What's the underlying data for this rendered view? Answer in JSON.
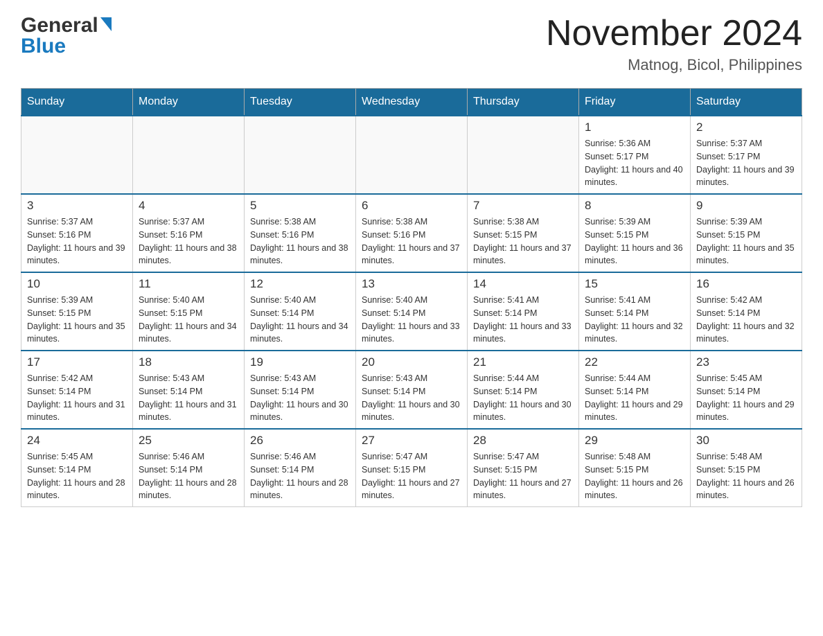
{
  "header": {
    "logo": {
      "general_text": "General",
      "blue_text": "Blue"
    },
    "month_title": "November 2024",
    "location": "Matnog, Bicol, Philippines"
  },
  "days_of_week": [
    "Sunday",
    "Monday",
    "Tuesday",
    "Wednesday",
    "Thursday",
    "Friday",
    "Saturday"
  ],
  "weeks": [
    {
      "days": [
        {
          "number": "",
          "sunrise": "",
          "sunset": "",
          "daylight": ""
        },
        {
          "number": "",
          "sunrise": "",
          "sunset": "",
          "daylight": ""
        },
        {
          "number": "",
          "sunrise": "",
          "sunset": "",
          "daylight": ""
        },
        {
          "number": "",
          "sunrise": "",
          "sunset": "",
          "daylight": ""
        },
        {
          "number": "",
          "sunrise": "",
          "sunset": "",
          "daylight": ""
        },
        {
          "number": "1",
          "sunrise": "Sunrise: 5:36 AM",
          "sunset": "Sunset: 5:17 PM",
          "daylight": "Daylight: 11 hours and 40 minutes."
        },
        {
          "number": "2",
          "sunrise": "Sunrise: 5:37 AM",
          "sunset": "Sunset: 5:17 PM",
          "daylight": "Daylight: 11 hours and 39 minutes."
        }
      ]
    },
    {
      "days": [
        {
          "number": "3",
          "sunrise": "Sunrise: 5:37 AM",
          "sunset": "Sunset: 5:16 PM",
          "daylight": "Daylight: 11 hours and 39 minutes."
        },
        {
          "number": "4",
          "sunrise": "Sunrise: 5:37 AM",
          "sunset": "Sunset: 5:16 PM",
          "daylight": "Daylight: 11 hours and 38 minutes."
        },
        {
          "number": "5",
          "sunrise": "Sunrise: 5:38 AM",
          "sunset": "Sunset: 5:16 PM",
          "daylight": "Daylight: 11 hours and 38 minutes."
        },
        {
          "number": "6",
          "sunrise": "Sunrise: 5:38 AM",
          "sunset": "Sunset: 5:16 PM",
          "daylight": "Daylight: 11 hours and 37 minutes."
        },
        {
          "number": "7",
          "sunrise": "Sunrise: 5:38 AM",
          "sunset": "Sunset: 5:15 PM",
          "daylight": "Daylight: 11 hours and 37 minutes."
        },
        {
          "number": "8",
          "sunrise": "Sunrise: 5:39 AM",
          "sunset": "Sunset: 5:15 PM",
          "daylight": "Daylight: 11 hours and 36 minutes."
        },
        {
          "number": "9",
          "sunrise": "Sunrise: 5:39 AM",
          "sunset": "Sunset: 5:15 PM",
          "daylight": "Daylight: 11 hours and 35 minutes."
        }
      ]
    },
    {
      "days": [
        {
          "number": "10",
          "sunrise": "Sunrise: 5:39 AM",
          "sunset": "Sunset: 5:15 PM",
          "daylight": "Daylight: 11 hours and 35 minutes."
        },
        {
          "number": "11",
          "sunrise": "Sunrise: 5:40 AM",
          "sunset": "Sunset: 5:15 PM",
          "daylight": "Daylight: 11 hours and 34 minutes."
        },
        {
          "number": "12",
          "sunrise": "Sunrise: 5:40 AM",
          "sunset": "Sunset: 5:14 PM",
          "daylight": "Daylight: 11 hours and 34 minutes."
        },
        {
          "number": "13",
          "sunrise": "Sunrise: 5:40 AM",
          "sunset": "Sunset: 5:14 PM",
          "daylight": "Daylight: 11 hours and 33 minutes."
        },
        {
          "number": "14",
          "sunrise": "Sunrise: 5:41 AM",
          "sunset": "Sunset: 5:14 PM",
          "daylight": "Daylight: 11 hours and 33 minutes."
        },
        {
          "number": "15",
          "sunrise": "Sunrise: 5:41 AM",
          "sunset": "Sunset: 5:14 PM",
          "daylight": "Daylight: 11 hours and 32 minutes."
        },
        {
          "number": "16",
          "sunrise": "Sunrise: 5:42 AM",
          "sunset": "Sunset: 5:14 PM",
          "daylight": "Daylight: 11 hours and 32 minutes."
        }
      ]
    },
    {
      "days": [
        {
          "number": "17",
          "sunrise": "Sunrise: 5:42 AM",
          "sunset": "Sunset: 5:14 PM",
          "daylight": "Daylight: 11 hours and 31 minutes."
        },
        {
          "number": "18",
          "sunrise": "Sunrise: 5:43 AM",
          "sunset": "Sunset: 5:14 PM",
          "daylight": "Daylight: 11 hours and 31 minutes."
        },
        {
          "number": "19",
          "sunrise": "Sunrise: 5:43 AM",
          "sunset": "Sunset: 5:14 PM",
          "daylight": "Daylight: 11 hours and 30 minutes."
        },
        {
          "number": "20",
          "sunrise": "Sunrise: 5:43 AM",
          "sunset": "Sunset: 5:14 PM",
          "daylight": "Daylight: 11 hours and 30 minutes."
        },
        {
          "number": "21",
          "sunrise": "Sunrise: 5:44 AM",
          "sunset": "Sunset: 5:14 PM",
          "daylight": "Daylight: 11 hours and 30 minutes."
        },
        {
          "number": "22",
          "sunrise": "Sunrise: 5:44 AM",
          "sunset": "Sunset: 5:14 PM",
          "daylight": "Daylight: 11 hours and 29 minutes."
        },
        {
          "number": "23",
          "sunrise": "Sunrise: 5:45 AM",
          "sunset": "Sunset: 5:14 PM",
          "daylight": "Daylight: 11 hours and 29 minutes."
        }
      ]
    },
    {
      "days": [
        {
          "number": "24",
          "sunrise": "Sunrise: 5:45 AM",
          "sunset": "Sunset: 5:14 PM",
          "daylight": "Daylight: 11 hours and 28 minutes."
        },
        {
          "number": "25",
          "sunrise": "Sunrise: 5:46 AM",
          "sunset": "Sunset: 5:14 PM",
          "daylight": "Daylight: 11 hours and 28 minutes."
        },
        {
          "number": "26",
          "sunrise": "Sunrise: 5:46 AM",
          "sunset": "Sunset: 5:14 PM",
          "daylight": "Daylight: 11 hours and 28 minutes."
        },
        {
          "number": "27",
          "sunrise": "Sunrise: 5:47 AM",
          "sunset": "Sunset: 5:15 PM",
          "daylight": "Daylight: 11 hours and 27 minutes."
        },
        {
          "number": "28",
          "sunrise": "Sunrise: 5:47 AM",
          "sunset": "Sunset: 5:15 PM",
          "daylight": "Daylight: 11 hours and 27 minutes."
        },
        {
          "number": "29",
          "sunrise": "Sunrise: 5:48 AM",
          "sunset": "Sunset: 5:15 PM",
          "daylight": "Daylight: 11 hours and 26 minutes."
        },
        {
          "number": "30",
          "sunrise": "Sunrise: 5:48 AM",
          "sunset": "Sunset: 5:15 PM",
          "daylight": "Daylight: 11 hours and 26 minutes."
        }
      ]
    }
  ]
}
